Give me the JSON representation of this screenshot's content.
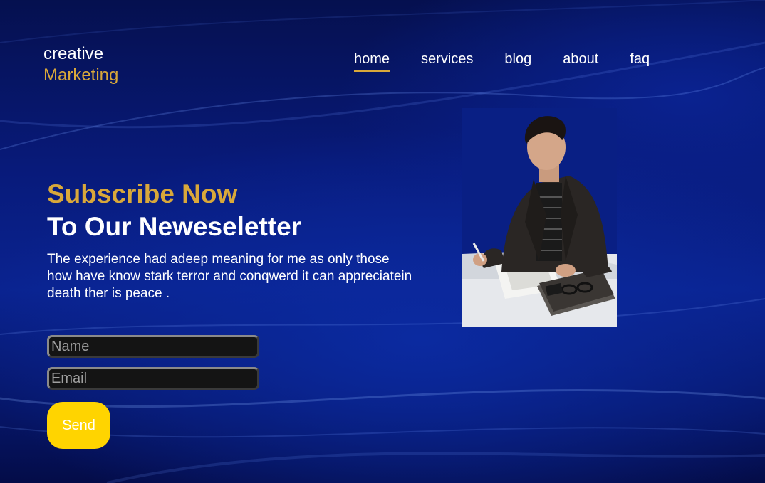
{
  "brand": {
    "line1": "creative",
    "line2": "Marketing",
    "accent_color": "#d9a83a"
  },
  "nav": {
    "items": [
      {
        "label": "home",
        "active": true
      },
      {
        "label": "services",
        "active": false
      },
      {
        "label": "blog",
        "active": false
      },
      {
        "label": "about",
        "active": false
      },
      {
        "label": "faq",
        "active": false
      }
    ],
    "active_underline_color": "#d9a83a"
  },
  "hero": {
    "headline_accent": "Subscribe Now",
    "headline_main": "To Our Neweseletter",
    "description": "The experience had adeep meaning for me as only those how have know stark terror and conqwerd it can appreciatein death ther is peace ."
  },
  "form": {
    "name_placeholder": "Name",
    "email_placeholder": "Email",
    "send_label": "Send",
    "send_color": "#ffd400"
  },
  "image": {
    "subject": "man in dark blazer writing at a desk with sketches and a notebook"
  }
}
